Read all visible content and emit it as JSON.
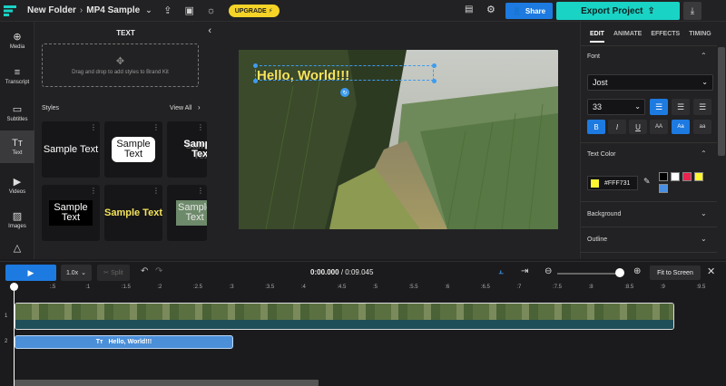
{
  "topbar": {
    "folder": "New Folder",
    "separator": "›",
    "project": "MP4 Sample",
    "upgrade": "UPGRADE ⚡",
    "share": "Share",
    "export": "Export Project"
  },
  "leftnav": {
    "items": [
      {
        "label": "Media",
        "icon": "media-icon"
      },
      {
        "label": "Transcript",
        "icon": "transcript-icon"
      },
      {
        "label": "Subtitles",
        "icon": "subtitles-icon"
      },
      {
        "label": "Text",
        "icon": "text-icon"
      },
      {
        "label": "Videos",
        "icon": "videos-icon"
      },
      {
        "label": "Images",
        "icon": "images-icon"
      }
    ]
  },
  "textpanel": {
    "title": "TEXT",
    "dropzone": "Drag and drop to add styles to Brand Kit",
    "styles_label": "Styles",
    "view_all": "View All",
    "cards": [
      {
        "text": "Sample Text"
      },
      {
        "text": "Sample Text"
      },
      {
        "text": "Sample Text"
      },
      {
        "text": "Sample Text"
      },
      {
        "text": "Sample Text"
      },
      {
        "text": "Sample Text"
      }
    ]
  },
  "canvas": {
    "overlay_text": "Hello, World!!!"
  },
  "rightpanel": {
    "tabs": [
      "EDIT",
      "ANIMATE",
      "EFFECTS",
      "TIMING"
    ],
    "font_label": "Font",
    "font_value": "Jost",
    "size_value": "33",
    "format_buttons": [
      "B",
      "I",
      "U",
      "AA",
      "Aa",
      "aa"
    ],
    "text_color_label": "Text Color",
    "color_hex": "#FFF731",
    "swatches": [
      "#000000",
      "#ffffff",
      "#e8244f",
      "#fff731",
      "#4a90e2"
    ],
    "background_label": "Background",
    "outline_label": "Outline"
  },
  "timeline": {
    "speed": "1.0x",
    "split": "Split",
    "current_time": "0:00.000",
    "total_time": "/ 0:09.045",
    "fit": "Fit to Screen",
    "ticks": [
      ":0",
      ":.5",
      ":1",
      ":1.5",
      ":2",
      ":2.5",
      ":3",
      ":3.5",
      ":4",
      ":4.5",
      ":5",
      ":5.5",
      ":6",
      ":6.5",
      ":7",
      ":7.5",
      ":8",
      ":8.5",
      ":9",
      ":9.5"
    ],
    "track1_no": "1",
    "track2_no": "2",
    "text_clip": "Hello, World!!!",
    "text_clip_icon": "Tт"
  }
}
